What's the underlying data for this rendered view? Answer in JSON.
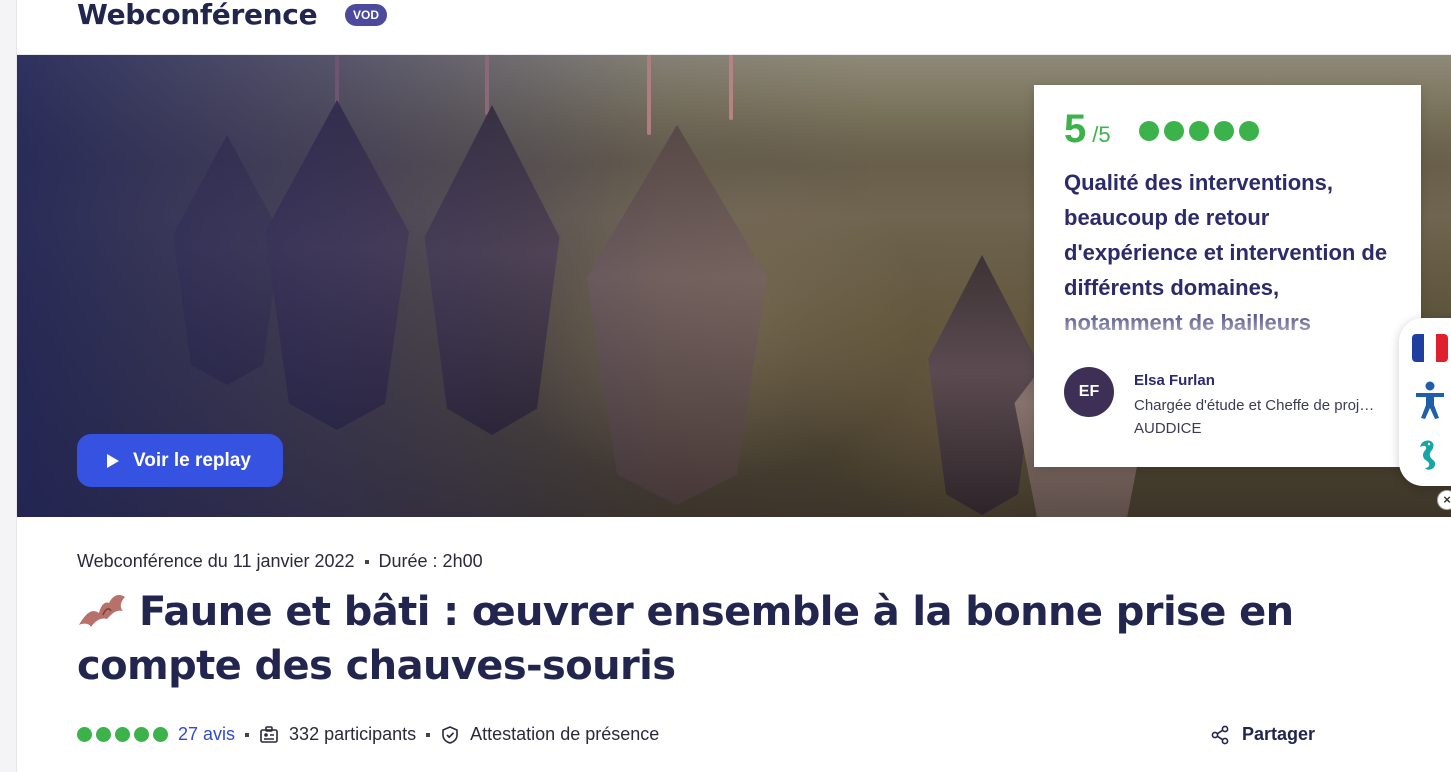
{
  "header": {
    "brand": "Webconférence",
    "badge": "VOD"
  },
  "hero": {
    "replay_label": "Voir le replay"
  },
  "review": {
    "score": "5",
    "scale": "/5",
    "rating_dots": 5,
    "quote": "Qualité des interventions, beaucoup de retour d'expérience et intervention de différents domaines, notamment de bailleurs",
    "author": {
      "initials": "EF",
      "name": "Elsa Furlan",
      "role": "Chargée d'étude et Cheffe de proj…",
      "org": "AUDDICE"
    }
  },
  "side_widget": {
    "icons": [
      "flag-fr-icon",
      "accessibility-icon",
      "seahorse-icon"
    ],
    "close": "×"
  },
  "event": {
    "date_label": "Webconférence du 11 janvier 2022",
    "duration_label": "Durée : 2h00",
    "title": "Faune et bâti : œuvrer ensemble à la bonne prise en compte des chauves-souris"
  },
  "stats": {
    "rating_dots": 5,
    "reviews_label": "27 avis",
    "participants_label": "332 participants",
    "certificate_label": "Attestation de présence"
  },
  "share": {
    "label": "Partager"
  },
  "colors": {
    "accent": "#3652e0",
    "rating": "#3bb34a",
    "title": "#22264f",
    "badge": "#4b4a9c"
  }
}
